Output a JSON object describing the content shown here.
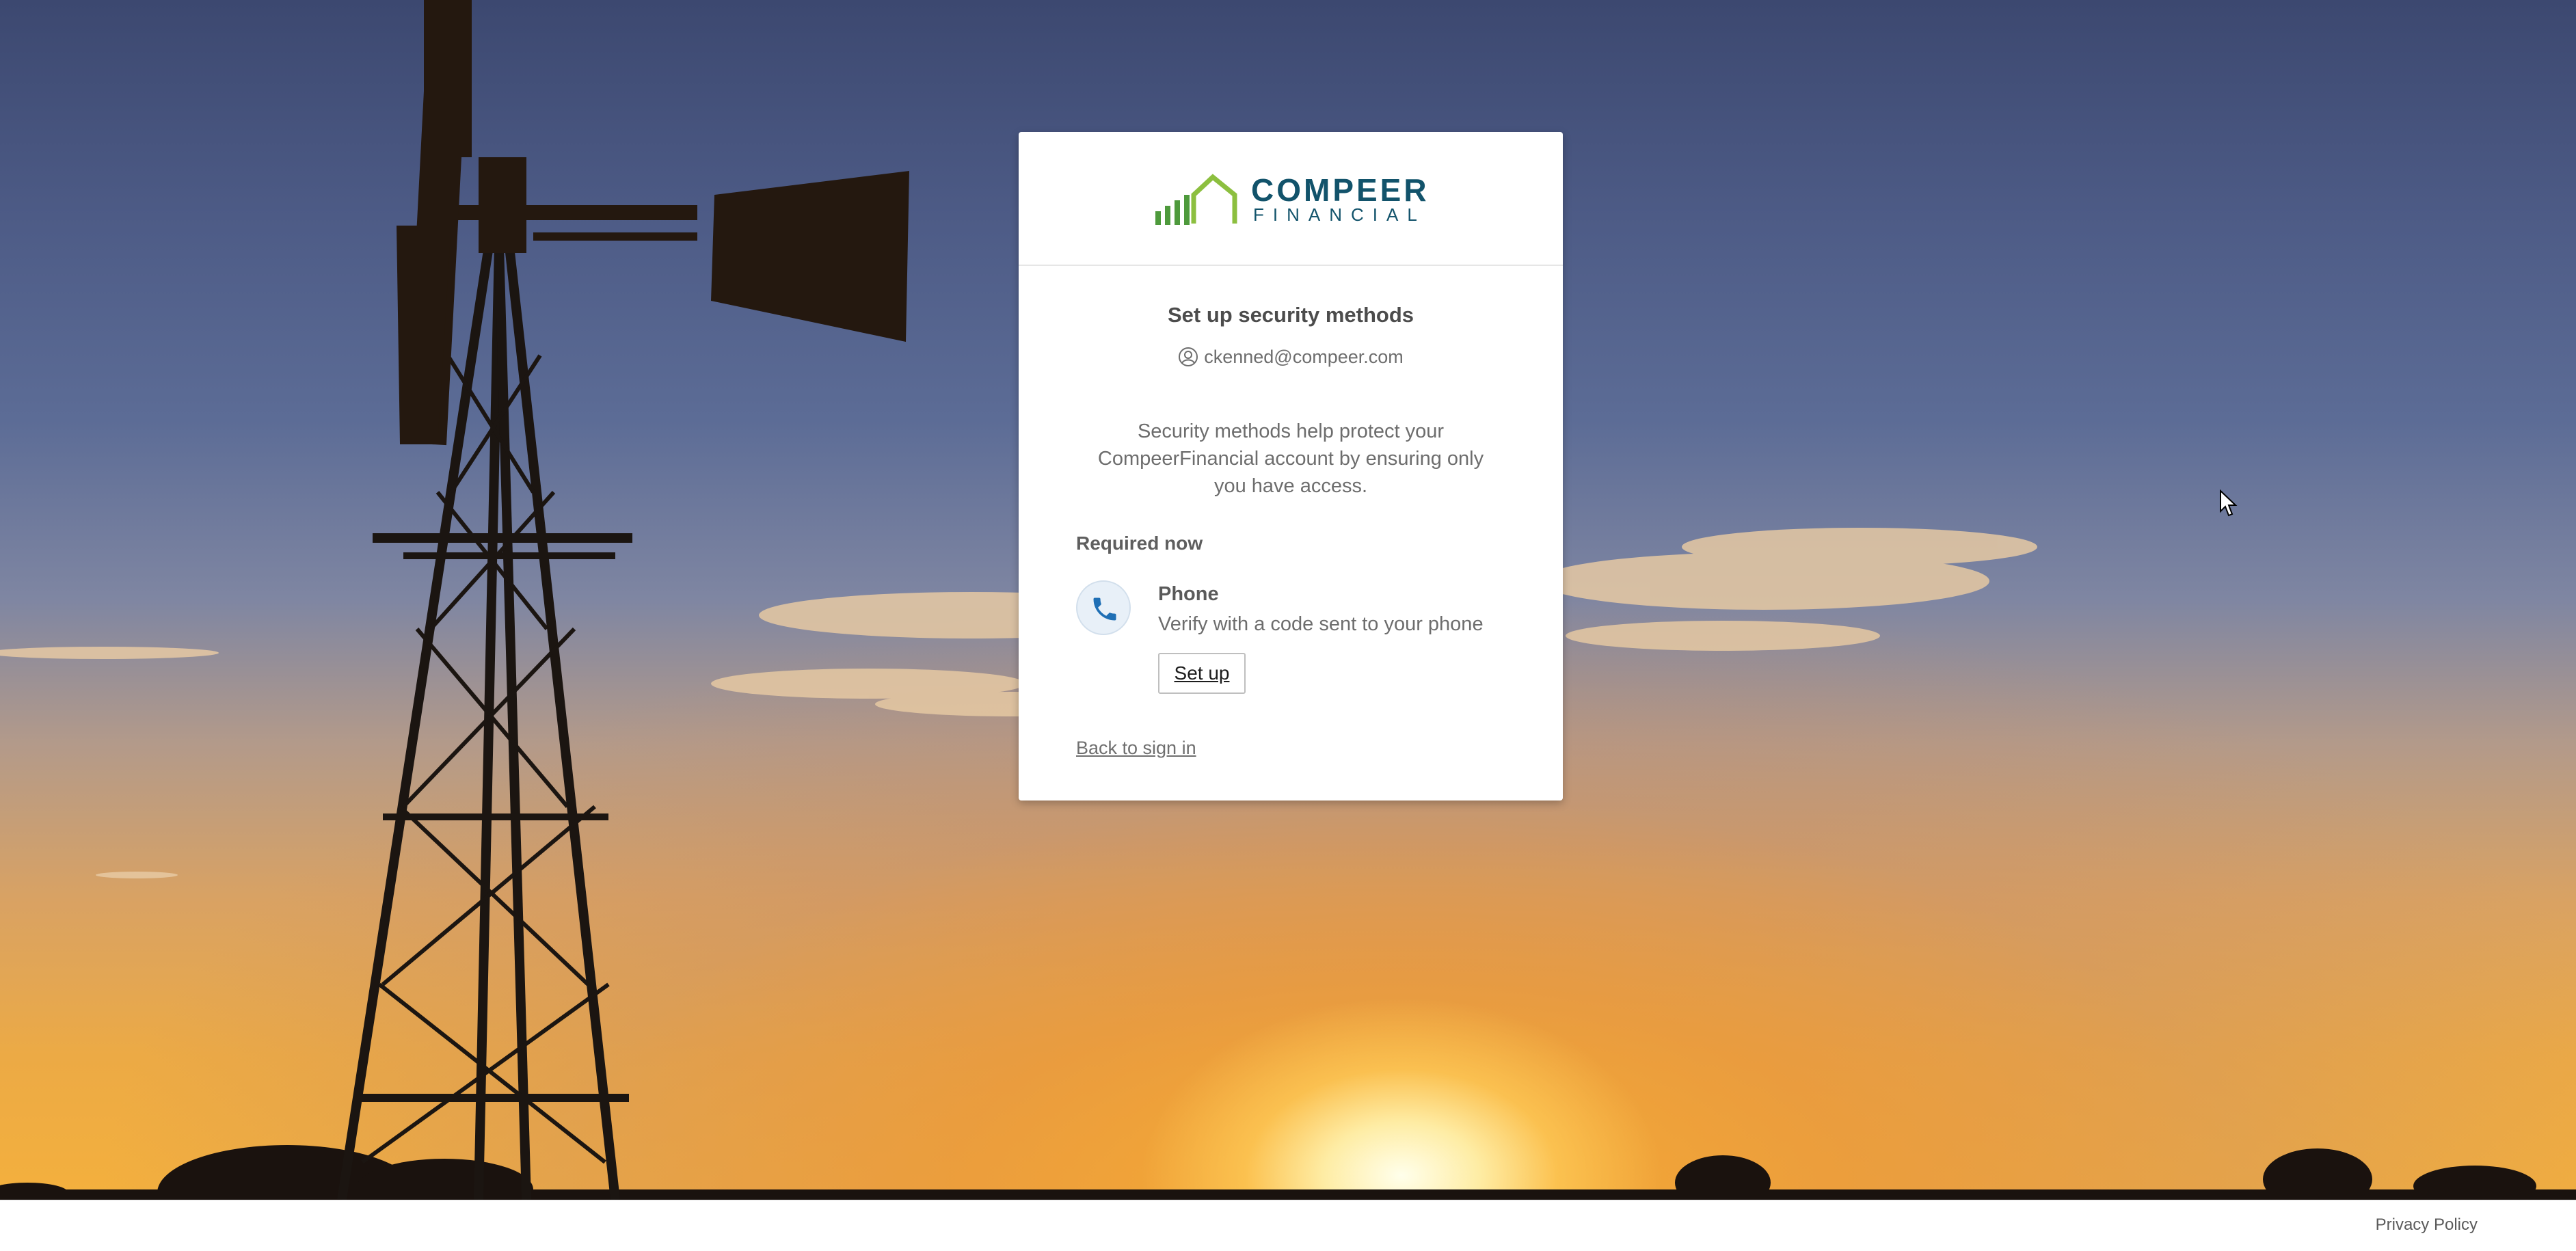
{
  "logo": {
    "line1": "COMPEER",
    "line2": "FINANCIAL"
  },
  "auth": {
    "title": "Set up security methods",
    "identifier": "ckenned@compeer.com",
    "description": "Security methods help protect your CompeerFinancial account by ensuring only you have access.",
    "required_label": "Required now",
    "method": {
      "icon": "phone-icon",
      "title": "Phone",
      "description": "Verify with a code sent to your phone",
      "button_label": "Set up"
    },
    "back_link": "Back to sign in"
  },
  "footer": {
    "privacy_link": "Privacy Policy"
  },
  "colors": {
    "brand": "#12536b",
    "brand_green": "#4e9a3c"
  }
}
